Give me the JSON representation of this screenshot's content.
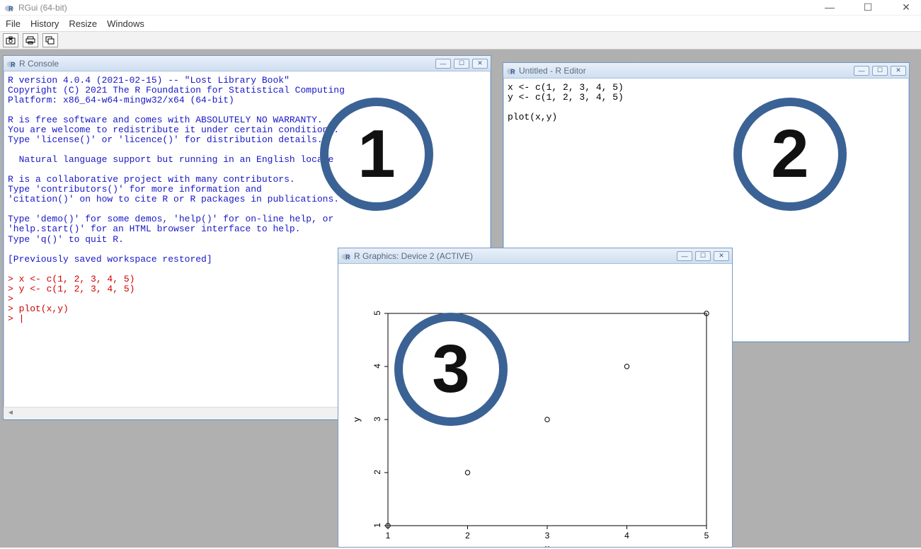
{
  "app": {
    "title": "RGui (64-bit)",
    "window_controls": {
      "min": "—",
      "max": "☐",
      "close": "✕"
    }
  },
  "menubar": [
    "File",
    "History",
    "Resize",
    "Windows"
  ],
  "toolbar_icons": [
    "camera-icon",
    "printer-icon",
    "cascade-icon"
  ],
  "console": {
    "title": "R Console",
    "blue_text": "R version 4.0.4 (2021-02-15) -- \"Lost Library Book\"\nCopyright (C) 2021 The R Foundation for Statistical Computing\nPlatform: x86_64-w64-mingw32/x64 (64-bit)\n\nR is free software and comes with ABSOLUTELY NO WARRANTY.\nYou are welcome to redistribute it under certain conditions.\nType 'license()' or 'licence()' for distribution details.\n\n  Natural language support but running in an English locale\n\nR is a collaborative project with many contributors.\nType 'contributors()' for more information and\n'citation()' on how to cite R or R packages in publications.\n\nType 'demo()' for some demos, 'help()' for on-line help, or\n'help.start()' for an HTML browser interface to help.\nType 'q()' to quit R.\n\n[Previously saved workspace restored]\n",
    "red_text": "> x <- c(1, 2, 3, 4, 5)\n> y <- c(1, 2, 3, 4, 5)\n> \n> plot(x,y)\n> "
  },
  "editor": {
    "title": "Untitled - R Editor",
    "content": "x <- c(1, 2, 3, 4, 5)\ny <- c(1, 2, 3, 4, 5)\n\nplot(x,y)"
  },
  "graphics": {
    "title": "R Graphics: Device 2 (ACTIVE)"
  },
  "annotations": {
    "one": "1",
    "two": "2",
    "three": "3"
  },
  "chart_data": {
    "type": "scatter",
    "x": [
      1,
      2,
      3,
      4,
      5
    ],
    "y": [
      1,
      2,
      3,
      4,
      5
    ],
    "xlabel": "x",
    "ylabel": "y",
    "xlim": [
      1,
      5
    ],
    "ylim": [
      1,
      5
    ],
    "x_ticks": [
      1,
      2,
      3,
      4,
      5
    ],
    "y_ticks": [
      1,
      2,
      3,
      4,
      5
    ]
  }
}
